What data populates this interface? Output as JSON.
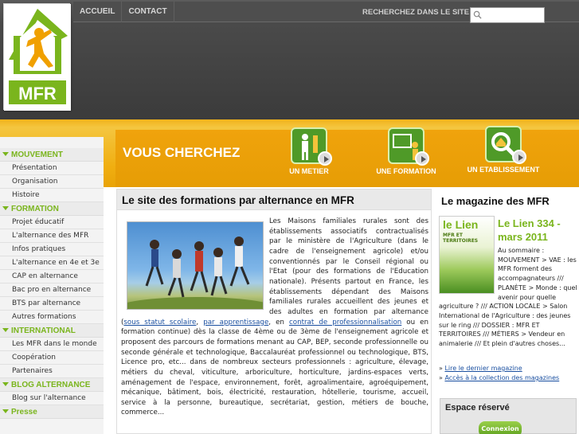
{
  "header": {
    "nav": [
      "ACCUEIL",
      "CONTACT"
    ],
    "search_label": "RECHERCHEZ DANS LE SITE",
    "search_placeholder": "",
    "logo_text": "MFR"
  },
  "band": {
    "title": "VOUS CHERCHEZ",
    "categories": [
      {
        "label": "UN METIER",
        "icon": "worker-icon"
      },
      {
        "label": "UNE FORMATION",
        "icon": "teacher-board-icon"
      },
      {
        "label": "UN ETABLISSEMENT",
        "icon": "magnifier-house-icon"
      }
    ]
  },
  "sidebar": {
    "sections": [
      {
        "title": "MOUVEMENT",
        "items": [
          "Présentation",
          "Organisation",
          "Histoire"
        ]
      },
      {
        "title": "FORMATION",
        "items": [
          "Projet éducatif",
          "L'alternance des MFR",
          "Infos pratiques",
          "L'alternance en 4e et 3e",
          "CAP en alternance",
          "Bac pro en alternance",
          "BTS par alternance",
          "Autres formations"
        ]
      },
      {
        "title": "INTERNATIONAL",
        "items": [
          "Les MFR dans le monde",
          "Coopération",
          "Partenaires"
        ]
      },
      {
        "title": "BLOG ALTERNANCE",
        "items": [
          "Blog sur l'alternance"
        ]
      }
    ],
    "cut_item": "Presse"
  },
  "article": {
    "title": "Le site des formations par alternance en MFR",
    "text_1": "Les Maisons familiales rurales sont des établissements associatifs contractualisés par le ministère de l'Agriculture (dans le cadre de l'enseignement agricole) et/ou conventionnés par le Conseil régional ou l'Etat (pour des formations de l'Education nationale). Présents partout en France, les établissements dépendant des Maisons familiales rurales accueillent des jeunes et des adultes en formation par alternance (",
    "link_1": "sous statut scolaire",
    "text_2": ", ",
    "link_2": "par apprentissage",
    "text_3": ", en ",
    "link_3": "contrat de professionnalisation",
    "text_4": " ou en formation continue) dès la classe de 4ème ou de 3ème de l'enseignement agricole et proposent des parcours de formations menant au CAP, BEP, seconde professionnelle ou seconde générale et technologique, Baccalauréat professionnel ou technologique, BTS, Licence pro, etc... dans de nombreux secteurs professionnels : agriculture, élevage, métiers du cheval, viticulture, arboriculture, horticulture, jardins-espaces verts, aménagement de l'espace, environnement, forêt, agroalimentaire, agroéquipement, mécanique, bâtiment, bois, électricité, restauration, hôtellerie, tourisme, accueil, service à la personne, bureautique, secrétariat, gestion, métiers de bouche, commerce..."
  },
  "magazine": {
    "heading": "Le magazine des MFR",
    "cover_brand": "le Lien",
    "cover_subtitle": "MFR ET TERRITOIRES",
    "issue_title": "Le Lien 334 - mars 2011",
    "summary": "Au sommaire : MOUVEMENT > VAE : les MFR forment des accompagnateurs /// PLANÈTE > Monde : quel avenir pour quelle agriculture ? /// ACTION LOCALE > Salon International de l'Agriculture : des jeunes sur le ring /// DOSSIER : MFR ET TERRITOIRES /// MÉTIERS > Vendeur en animalerie /// Et plein d'autres choses...",
    "link_read": "Lire le dernier magazine",
    "link_collection": "Accès à la collection des magazines"
  },
  "espace": {
    "title": "Espace réservé",
    "button": "Connexion"
  },
  "colors": {
    "accent_green": "#7ab51d",
    "band_yellow": "#f0ae10",
    "header_grey": "#4a4a4a"
  }
}
